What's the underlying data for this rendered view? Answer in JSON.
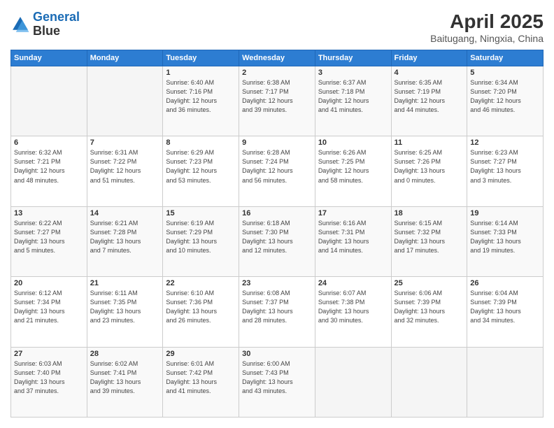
{
  "header": {
    "logo_line1": "General",
    "logo_line2": "Blue",
    "title": "April 2025",
    "subtitle": "Baitugang, Ningxia, China"
  },
  "weekdays": [
    "Sunday",
    "Monday",
    "Tuesday",
    "Wednesday",
    "Thursday",
    "Friday",
    "Saturday"
  ],
  "weeks": [
    [
      {
        "day": "",
        "info": ""
      },
      {
        "day": "",
        "info": ""
      },
      {
        "day": "1",
        "info": "Sunrise: 6:40 AM\nSunset: 7:16 PM\nDaylight: 12 hours\nand 36 minutes."
      },
      {
        "day": "2",
        "info": "Sunrise: 6:38 AM\nSunset: 7:17 PM\nDaylight: 12 hours\nand 39 minutes."
      },
      {
        "day": "3",
        "info": "Sunrise: 6:37 AM\nSunset: 7:18 PM\nDaylight: 12 hours\nand 41 minutes."
      },
      {
        "day": "4",
        "info": "Sunrise: 6:35 AM\nSunset: 7:19 PM\nDaylight: 12 hours\nand 44 minutes."
      },
      {
        "day": "5",
        "info": "Sunrise: 6:34 AM\nSunset: 7:20 PM\nDaylight: 12 hours\nand 46 minutes."
      }
    ],
    [
      {
        "day": "6",
        "info": "Sunrise: 6:32 AM\nSunset: 7:21 PM\nDaylight: 12 hours\nand 48 minutes."
      },
      {
        "day": "7",
        "info": "Sunrise: 6:31 AM\nSunset: 7:22 PM\nDaylight: 12 hours\nand 51 minutes."
      },
      {
        "day": "8",
        "info": "Sunrise: 6:29 AM\nSunset: 7:23 PM\nDaylight: 12 hours\nand 53 minutes."
      },
      {
        "day": "9",
        "info": "Sunrise: 6:28 AM\nSunset: 7:24 PM\nDaylight: 12 hours\nand 56 minutes."
      },
      {
        "day": "10",
        "info": "Sunrise: 6:26 AM\nSunset: 7:25 PM\nDaylight: 12 hours\nand 58 minutes."
      },
      {
        "day": "11",
        "info": "Sunrise: 6:25 AM\nSunset: 7:26 PM\nDaylight: 13 hours\nand 0 minutes."
      },
      {
        "day": "12",
        "info": "Sunrise: 6:23 AM\nSunset: 7:27 PM\nDaylight: 13 hours\nand 3 minutes."
      }
    ],
    [
      {
        "day": "13",
        "info": "Sunrise: 6:22 AM\nSunset: 7:27 PM\nDaylight: 13 hours\nand 5 minutes."
      },
      {
        "day": "14",
        "info": "Sunrise: 6:21 AM\nSunset: 7:28 PM\nDaylight: 13 hours\nand 7 minutes."
      },
      {
        "day": "15",
        "info": "Sunrise: 6:19 AM\nSunset: 7:29 PM\nDaylight: 13 hours\nand 10 minutes."
      },
      {
        "day": "16",
        "info": "Sunrise: 6:18 AM\nSunset: 7:30 PM\nDaylight: 13 hours\nand 12 minutes."
      },
      {
        "day": "17",
        "info": "Sunrise: 6:16 AM\nSunset: 7:31 PM\nDaylight: 13 hours\nand 14 minutes."
      },
      {
        "day": "18",
        "info": "Sunrise: 6:15 AM\nSunset: 7:32 PM\nDaylight: 13 hours\nand 17 minutes."
      },
      {
        "day": "19",
        "info": "Sunrise: 6:14 AM\nSunset: 7:33 PM\nDaylight: 13 hours\nand 19 minutes."
      }
    ],
    [
      {
        "day": "20",
        "info": "Sunrise: 6:12 AM\nSunset: 7:34 PM\nDaylight: 13 hours\nand 21 minutes."
      },
      {
        "day": "21",
        "info": "Sunrise: 6:11 AM\nSunset: 7:35 PM\nDaylight: 13 hours\nand 23 minutes."
      },
      {
        "day": "22",
        "info": "Sunrise: 6:10 AM\nSunset: 7:36 PM\nDaylight: 13 hours\nand 26 minutes."
      },
      {
        "day": "23",
        "info": "Sunrise: 6:08 AM\nSunset: 7:37 PM\nDaylight: 13 hours\nand 28 minutes."
      },
      {
        "day": "24",
        "info": "Sunrise: 6:07 AM\nSunset: 7:38 PM\nDaylight: 13 hours\nand 30 minutes."
      },
      {
        "day": "25",
        "info": "Sunrise: 6:06 AM\nSunset: 7:39 PM\nDaylight: 13 hours\nand 32 minutes."
      },
      {
        "day": "26",
        "info": "Sunrise: 6:04 AM\nSunset: 7:39 PM\nDaylight: 13 hours\nand 34 minutes."
      }
    ],
    [
      {
        "day": "27",
        "info": "Sunrise: 6:03 AM\nSunset: 7:40 PM\nDaylight: 13 hours\nand 37 minutes."
      },
      {
        "day": "28",
        "info": "Sunrise: 6:02 AM\nSunset: 7:41 PM\nDaylight: 13 hours\nand 39 minutes."
      },
      {
        "day": "29",
        "info": "Sunrise: 6:01 AM\nSunset: 7:42 PM\nDaylight: 13 hours\nand 41 minutes."
      },
      {
        "day": "30",
        "info": "Sunrise: 6:00 AM\nSunset: 7:43 PM\nDaylight: 13 hours\nand 43 minutes."
      },
      {
        "day": "",
        "info": ""
      },
      {
        "day": "",
        "info": ""
      },
      {
        "day": "",
        "info": ""
      }
    ]
  ]
}
